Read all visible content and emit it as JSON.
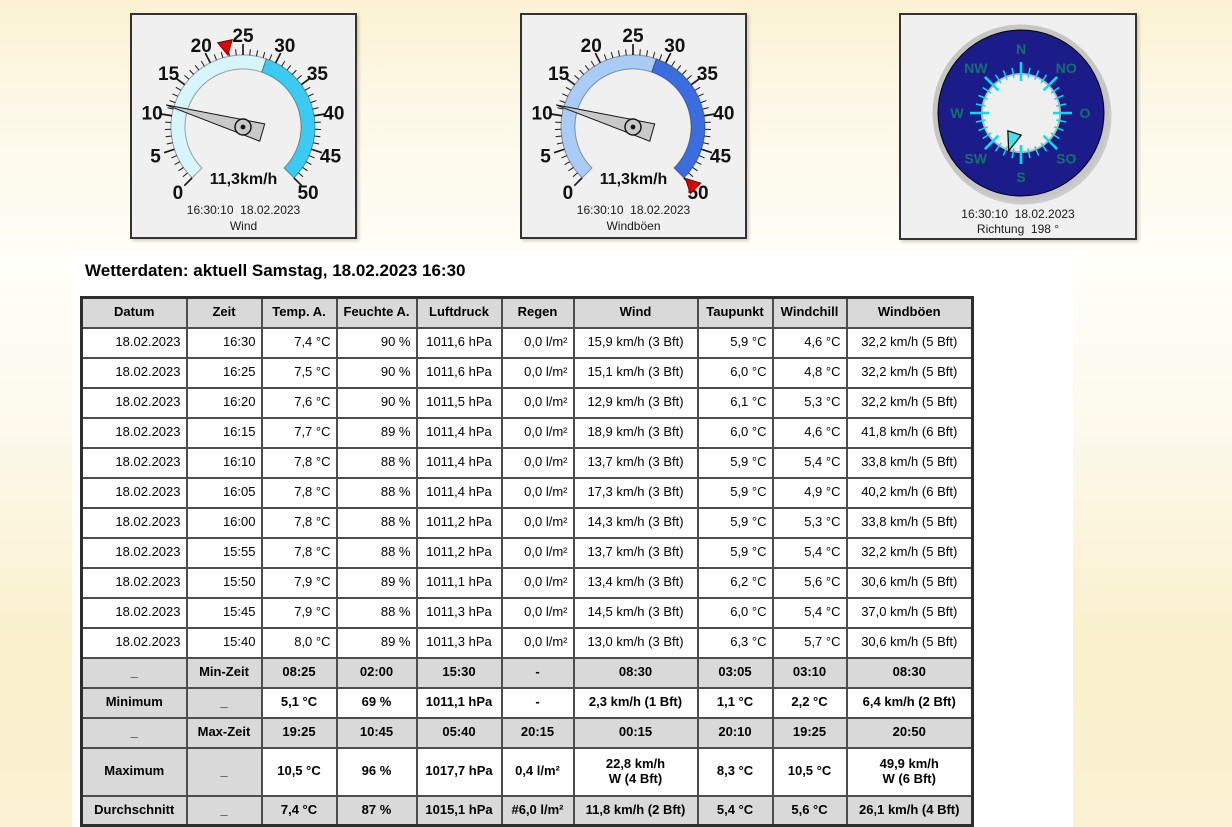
{
  "gauges": [
    {
      "label": "Wind",
      "value": 11.3,
      "value_text": "11,3km/h",
      "timestamp": "16:30:10  18.02.2023",
      "min": 0,
      "max": 50,
      "scale_labels": [
        0,
        5,
        10,
        15,
        20,
        25,
        30,
        35,
        40,
        45,
        50
      ],
      "band_split": 28.5,
      "band_low_color": "#d7f6fc",
      "band_high_color": "#3bcbf2",
      "marker_value": 22.8,
      "marker_color": "#dd0000",
      "needle_color": "#c9c9c9"
    },
    {
      "label": "Windböen",
      "value": 11.3,
      "value_text": "11,3km/h",
      "timestamp": "16:30:10  18.02.2023",
      "min": 0,
      "max": 50,
      "scale_labels": [
        0,
        5,
        10,
        15,
        20,
        25,
        30,
        35,
        40,
        45,
        50
      ],
      "band_split": 28.5,
      "band_low_color": "#a9cbf5",
      "band_high_color": "#3b6de0",
      "marker_value": 49.9,
      "marker_color": "#dd0000",
      "needle_color": "#c9c9c9"
    }
  ],
  "compass": {
    "direction_deg": 198,
    "labels": [
      "N",
      "NO",
      "O",
      "SO",
      "S",
      "SW",
      "W",
      "NW"
    ],
    "timestamp": "16:30:10  18.02.2023",
    "caption": "Richtung  198 °",
    "ring_color": "#1b1b8a",
    "outer_ring_color": "#c6c6c6",
    "inner_circle_color": "#efefef",
    "tick_color": "#00dff2",
    "label_color": "#15706e",
    "pointer_color": "#3fe3e8"
  },
  "weather_table": {
    "title": "Wetterdaten: aktuell Samstag, 18.02.2023 16:30",
    "headers": [
      "Datum",
      "Zeit",
      "Temp. A.",
      "Feuchte A.",
      "Luftdruck",
      "Regen",
      "Wind",
      "Taupunkt",
      "Windchill",
      "Windböen"
    ],
    "data_rows": [
      [
        "18.02.2023",
        "16:30",
        "7,4 °C",
        "90 %",
        "1011,6 hPa",
        "0,0 l/m²",
        "15,9 km/h (3 Bft)",
        "5,9 °C",
        "4,6 °C",
        "32,2 km/h (5 Bft)"
      ],
      [
        "18.02.2023",
        "16:25",
        "7,5 °C",
        "90 %",
        "1011,6 hPa",
        "0,0 l/m²",
        "15,1 km/h (3 Bft)",
        "6,0 °C",
        "4,8 °C",
        "32,2 km/h (5 Bft)"
      ],
      [
        "18.02.2023",
        "16:20",
        "7,6 °C",
        "90 %",
        "1011,5 hPa",
        "0,0 l/m²",
        "12,9 km/h (3 Bft)",
        "6,1 °C",
        "5,3 °C",
        "32,2 km/h (5 Bft)"
      ],
      [
        "18.02.2023",
        "16:15",
        "7,7 °C",
        "89 %",
        "1011,4 hPa",
        "0,0 l/m²",
        "18,9 km/h (3 Bft)",
        "6,0 °C",
        "4,6 °C",
        "41,8 km/h (6 Bft)"
      ],
      [
        "18.02.2023",
        "16:10",
        "7,8 °C",
        "88 %",
        "1011,4 hPa",
        "0,0 l/m²",
        "13,7 km/h (3 Bft)",
        "5,9 °C",
        "5,4 °C",
        "33,8 km/h (5 Bft)"
      ],
      [
        "18.02.2023",
        "16:05",
        "7,8 °C",
        "88 %",
        "1011,4 hPa",
        "0,0 l/m²",
        "17,3 km/h (3 Bft)",
        "5,9 °C",
        "4,9 °C",
        "40,2 km/h (6 Bft)"
      ],
      [
        "18.02.2023",
        "16:00",
        "7,8 °C",
        "88 %",
        "1011,2 hPa",
        "0,0 l/m²",
        "14,3 km/h (3 Bft)",
        "5,9 °C",
        "5,3 °C",
        "33,8 km/h (5 Bft)"
      ],
      [
        "18.02.2023",
        "15:55",
        "7,8 °C",
        "88 %",
        "1011,2 hPa",
        "0,0 l/m²",
        "13,7 km/h (3 Bft)",
        "5,9 °C",
        "5,4 °C",
        "32,2 km/h (5 Bft)"
      ],
      [
        "18.02.2023",
        "15:50",
        "7,9 °C",
        "89 %",
        "1011,1 hPa",
        "0,0 l/m²",
        "13,4 km/h (3 Bft)",
        "6,2 °C",
        "5,6 °C",
        "30,6 km/h (5 Bft)"
      ],
      [
        "18.02.2023",
        "15:45",
        "7,9 °C",
        "88 %",
        "1011,3 hPa",
        "0,0 l/m²",
        "14,5 km/h (3 Bft)",
        "6,0 °C",
        "5,4 °C",
        "37,0 km/h (5 Bft)"
      ],
      [
        "18.02.2023",
        "15:40",
        "8,0 °C",
        "89 %",
        "1011,3 hPa",
        "0,0 l/m²",
        "13,0 km/h (3 Bft)",
        "6,3 °C",
        "5,7 °C",
        "30,6 km/h (5 Bft)"
      ]
    ],
    "summary_rows": [
      {
        "kind": "gray",
        "tall": false,
        "cells": [
          "_",
          "Min-Zeit",
          "08:25",
          "02:00",
          "15:30",
          "-",
          "08:30",
          "03:05",
          "03:10",
          "08:30"
        ]
      },
      {
        "kind": "mixed",
        "tall": false,
        "cells": [
          "Minimum",
          "_",
          "5,1 °C",
          "69 %",
          "1011,1 hPa",
          "-",
          "2,3 km/h (1 Bft)",
          "1,1 °C",
          "2,2 °C",
          "6,4 km/h (2 Bft)"
        ]
      },
      {
        "kind": "gray",
        "tall": false,
        "cells": [
          "_",
          "Max-Zeit",
          "19:25",
          "10:45",
          "05:40",
          "20:15",
          "00:15",
          "20:10",
          "19:25",
          "20:50"
        ]
      },
      {
        "kind": "mixed",
        "tall": true,
        "cells": [
          "Maximum",
          "_",
          "10,5 °C",
          "96 %",
          "1017,7 hPa",
          "0,4 l/m²",
          "22,8 km/h\nW (4 Bft)",
          "8,3 °C",
          "10,5 °C",
          "49,9 km/h\nW (6 Bft)"
        ]
      },
      {
        "kind": "gray",
        "tall": false,
        "cells": [
          "Durchschnitt",
          "_",
          "7,4 °C",
          "87 %",
          "1015,1 hPa",
          "#6,0 l/m²",
          "11,8 km/h (2 Bft)",
          "5,4 °C",
          "5,6 °C",
          "26,1 km/h (4 Bft)"
        ]
      }
    ],
    "colors": {
      "header_bg": "#d9d9d9",
      "grid": "#4d4d4d"
    }
  }
}
